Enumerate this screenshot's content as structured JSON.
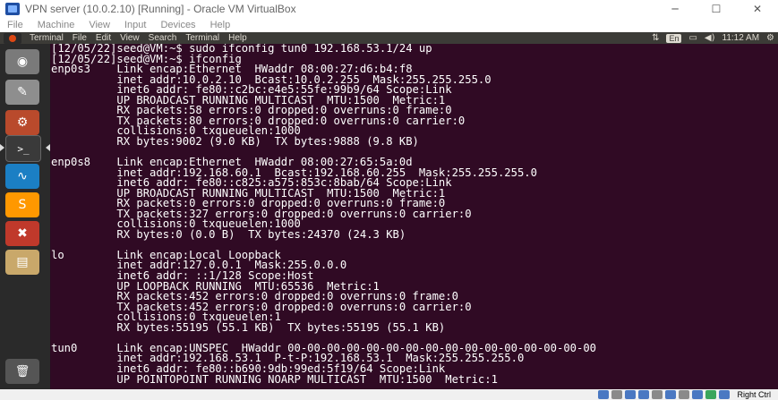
{
  "window": {
    "title": "VPN server (10.0.2.10) [Running] - Oracle VM VirtualBox",
    "controls": {
      "minimize": "─",
      "maximize": "☐",
      "close": "✕"
    }
  },
  "vbox_menu": {
    "items": [
      "File",
      "Machine",
      "View",
      "Input",
      "Devices",
      "Help"
    ]
  },
  "guest_panel": {
    "menu": [
      "Terminal",
      "File",
      "Edit",
      "View",
      "Search",
      "Terminal",
      "Help"
    ],
    "keyboard": "En",
    "time": "11:12 AM"
  },
  "launcher": {
    "items": [
      {
        "name": "dash-home",
        "icon": "ubuntu-logo"
      },
      {
        "name": "text-editor",
        "icon": "text-editor-icon"
      },
      {
        "name": "system-settings",
        "icon": "settings-icon"
      },
      {
        "name": "terminal",
        "icon": "terminal-icon",
        "active": true
      },
      {
        "name": "wireshark",
        "icon": "wireshark-icon"
      },
      {
        "name": "sublime-text",
        "icon": "sublime-icon"
      },
      {
        "name": "red-app",
        "icon": "red-app-icon"
      },
      {
        "name": "files",
        "icon": "files-icon"
      }
    ],
    "trash": "trash-icon"
  },
  "terminal": {
    "lines": [
      "[12/05/22]seed@VM:~$ sudo ifconfig tun0 192.168.53.1/24 up",
      "[12/05/22]seed@VM:~$ ifconfig",
      "enp0s3    Link encap:Ethernet  HWaddr 08:00:27:d6:b4:f8",
      "          inet addr:10.0.2.10  Bcast:10.0.2.255  Mask:255.255.255.0",
      "          inet6 addr: fe80::c2bc:e4e5:55fe:99b9/64 Scope:Link",
      "          UP BROADCAST RUNNING MULTICAST  MTU:1500  Metric:1",
      "          RX packets:58 errors:0 dropped:0 overruns:0 frame:0",
      "          TX packets:80 errors:0 dropped:0 overruns:0 carrier:0",
      "          collisions:0 txqueuelen:1000",
      "          RX bytes:9002 (9.0 KB)  TX bytes:9888 (9.8 KB)",
      "",
      "enp0s8    Link encap:Ethernet  HWaddr 08:00:27:65:5a:0d",
      "          inet addr:192.168.60.1  Bcast:192.168.60.255  Mask:255.255.255.0",
      "          inet6 addr: fe80::c825:a575:853c:8bab/64 Scope:Link",
      "          UP BROADCAST RUNNING MULTICAST  MTU:1500  Metric:1",
      "          RX packets:0 errors:0 dropped:0 overruns:0 frame:0",
      "          TX packets:327 errors:0 dropped:0 overruns:0 carrier:0",
      "          collisions:0 txqueuelen:1000",
      "          RX bytes:0 (0.0 B)  TX bytes:24370 (24.3 KB)",
      "",
      "lo        Link encap:Local Loopback",
      "          inet addr:127.0.0.1  Mask:255.0.0.0",
      "          inet6 addr: ::1/128 Scope:Host",
      "          UP LOOPBACK RUNNING  MTU:65536  Metric:1",
      "          RX packets:452 errors:0 dropped:0 overruns:0 frame:0",
      "          TX packets:452 errors:0 dropped:0 overruns:0 carrier:0",
      "          collisions:0 txqueuelen:1",
      "          RX bytes:55195 (55.1 KB)  TX bytes:55195 (55.1 KB)",
      "",
      "tun0      Link encap:UNSPEC  HWaddr 00-00-00-00-00-00-00-00-00-00-00-00-00-00-00-00",
      "          inet addr:192.168.53.1  P-t-P:192.168.53.1  Mask:255.255.255.0",
      "          inet6 addr: fe80::b690:9db:99ed:5f19/64 Scope:Link",
      "          UP POINTOPOINT RUNNING NOARP MULTICAST  MTU:1500  Metric:1"
    ]
  },
  "statusbar": {
    "host_key": "Right Ctrl"
  },
  "colors": {
    "terminal_bg": "#300a24",
    "terminal_fg": "#ffffff",
    "panel_bg": "#3c3b37",
    "launcher_bg": "#2a2a2a"
  }
}
